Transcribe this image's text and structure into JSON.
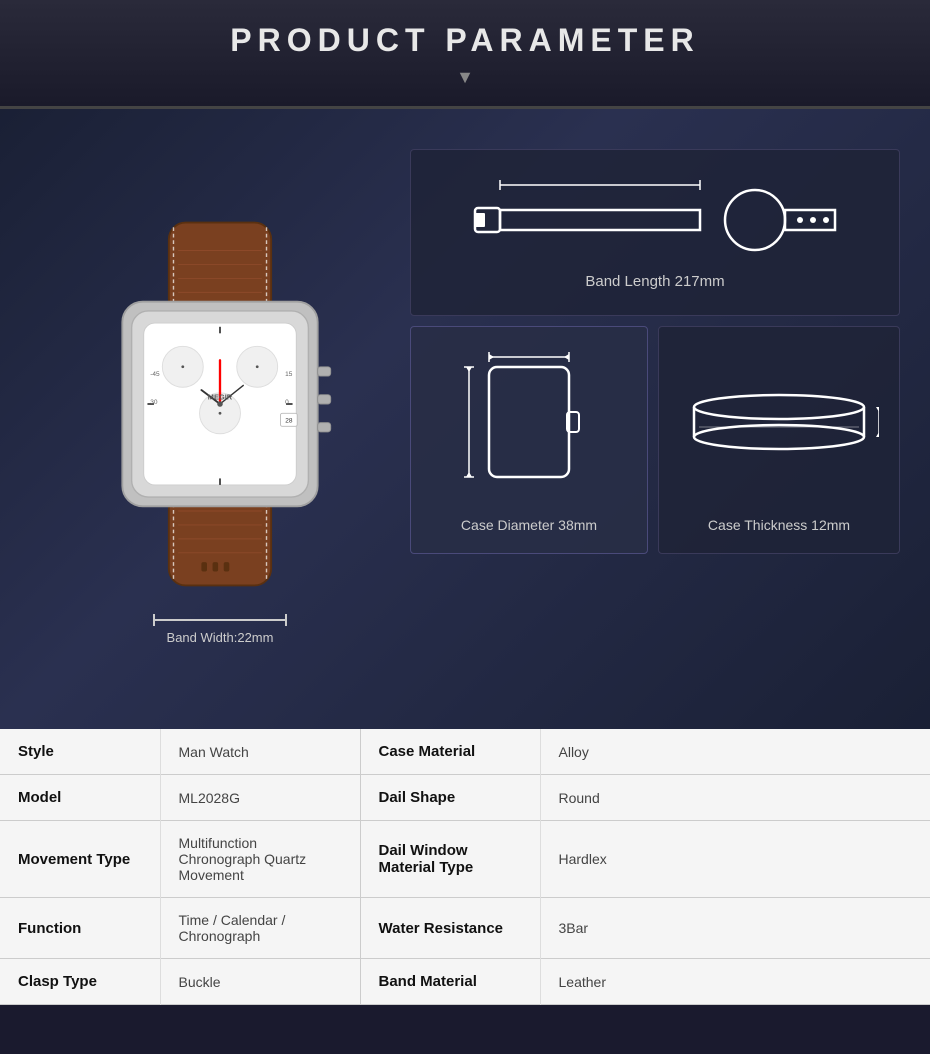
{
  "header": {
    "title": "PRODUCT PARAMETER"
  },
  "dimensions": {
    "band_length_label": "Band Length 217mm",
    "band_width_label": "Band Width:22mm",
    "case_diameter_label": "Case Diameter 38mm",
    "case_thickness_label": "Case Thickness 12mm"
  },
  "specs": [
    {
      "left_label": "Style",
      "left_value": "Man Watch",
      "right_label": "Case Material",
      "right_value": "Alloy"
    },
    {
      "left_label": "Model",
      "left_value": "ML2028G",
      "right_label": "Dail Shape",
      "right_value": "Round"
    },
    {
      "left_label": "Movement Type",
      "left_value": "Multifunction Chronograph Quartz Movement",
      "right_label": "Dail Window Material Type",
      "right_value": "Hardlex"
    },
    {
      "left_label": "Function",
      "left_value": "Time  /  Calendar /  Chronograph",
      "right_label": "Water Resistance",
      "right_value": "3Bar"
    },
    {
      "left_label": "Clasp Type",
      "left_value": "Buckle",
      "right_label": "Band Material",
      "right_value": "Leather"
    }
  ]
}
